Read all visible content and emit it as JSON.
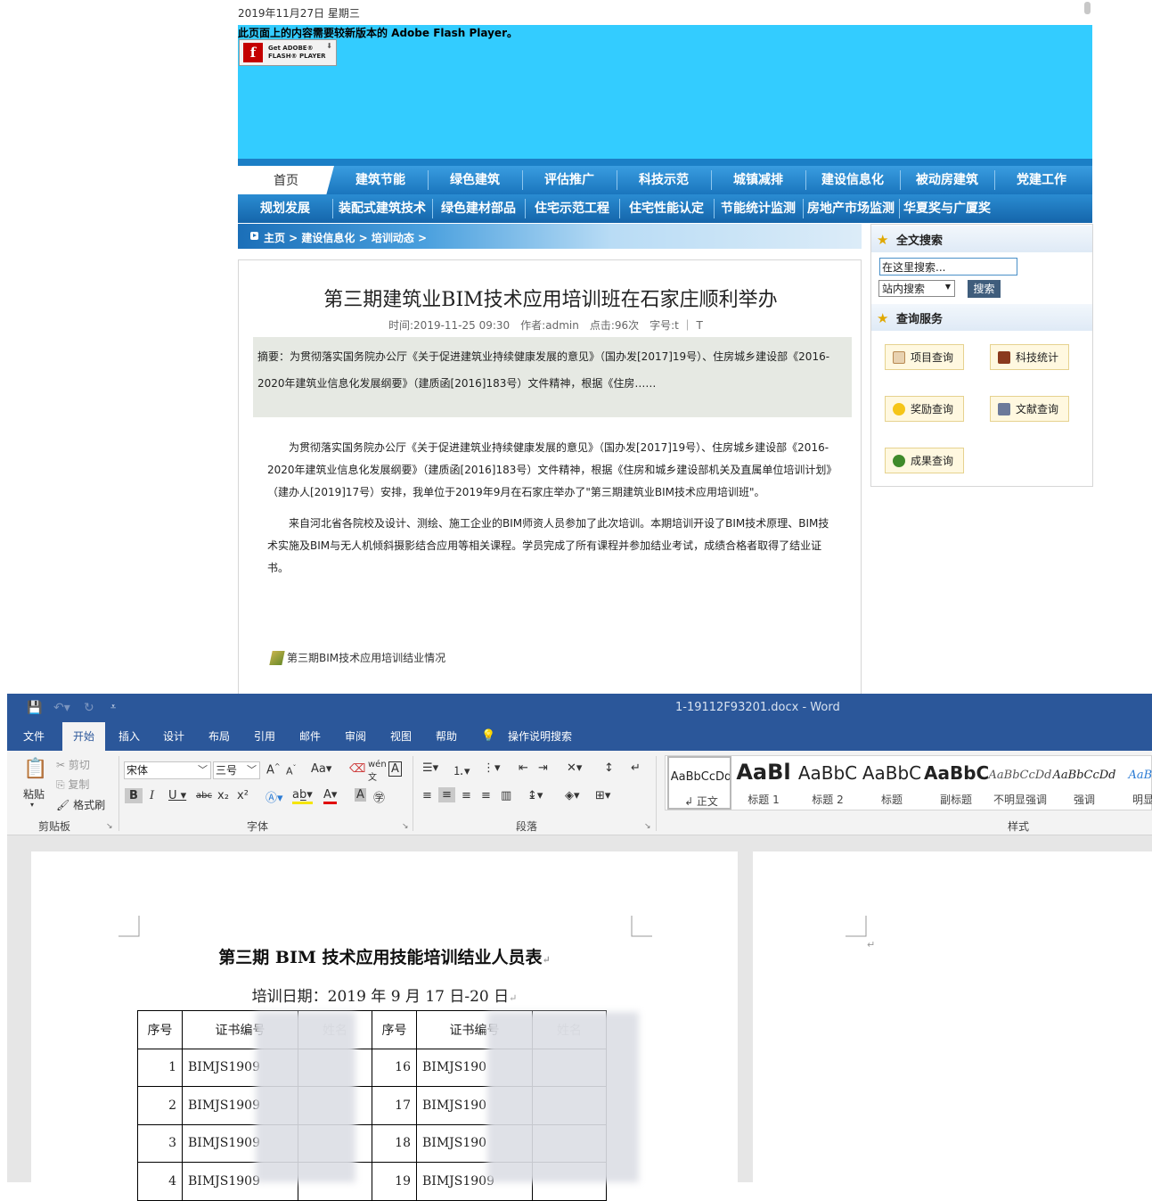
{
  "site": {
    "date": "2019年11月27日 星期三",
    "flash_message": "此页面上的内容需要较新版本的 Adobe Flash Player。",
    "flash_button": {
      "line1": "Get ADOBE®",
      "line2": "FLASH® PLAYER"
    },
    "nav_row1": [
      "首页",
      "建筑节能",
      "绿色建筑",
      "评估推广",
      "科技示范",
      "城镇减排",
      "建设信息化",
      "被动房建筑",
      "党建工作"
    ],
    "nav_row2": [
      "规划发展",
      "装配式建筑技术",
      "绿色建材部品",
      "住宅示范工程",
      "住宅性能认定",
      "节能统计监测",
      "房地产市场监测",
      "华夏奖与广厦奖"
    ],
    "breadcrumb": "主页 > 建设信息化 > 培训动态 >",
    "article": {
      "title": "第三期建筑业BIM技术应用培训班在石家庄顺利举办",
      "meta": "时间:2019-11-25 09:30　作者:admin　点击:96次　字号:t ｜ T",
      "abstract": "摘要：为贯彻落实国务院办公厅《关于促进建筑业持续健康发展的意见》（国办发[2017]19号）、住房城乡建设部《2016-2020年建筑业信息化发展纲要》（建质函[2016]183号）文件精神，根据《住房……",
      "para1": "为贯彻落实国务院办公厅《关于促进建筑业持续健康发展的意见》（国办发[2017]19号）、住房城乡建设部《2016-2020年建筑业信息化发展纲要》（建质函[2016]183号）文件精神，根据《住房和城乡建设部机关及直属单位培训计划》（建办人[2019]17号）安排，我单位于2019年9月在石家庄举办了\"第三期建筑业BIM技术应用培训班\"。",
      "para2": "来自河北省各院校及设计、测绘、施工企业的BIM师资人员参加了此次培训。本期培训开设了BIM技术原理、BIM技术实施及BIM与无人机倾斜摄影结合应用等相关课程。学员完成了所有课程并参加结业考试，成绩合格者取得了结业证书。",
      "attachment": "第三期BIM技术应用培训结业情况"
    },
    "sidebar": {
      "search_title": "全文搜索",
      "search_placeholder": "在这里搜索...",
      "search_scope": "站内搜索",
      "search_button": "搜索",
      "query_title": "查询服务",
      "query_buttons": [
        "项目查询",
        "科技统计",
        "奖励查询",
        "文献查询",
        "成果查询"
      ]
    }
  },
  "word": {
    "doc_title": "1-19112F93201.docx  -  Word",
    "tabs": [
      "文件",
      "开始",
      "插入",
      "设计",
      "布局",
      "引用",
      "邮件",
      "审阅",
      "视图",
      "帮助",
      "操作说明搜索"
    ],
    "active_tab": "开始",
    "clipboard": {
      "paste": "粘贴",
      "cut": "剪切",
      "copy": "复制",
      "format_painter": "格式刷",
      "group": "剪贴板"
    },
    "font": {
      "name": "宋体",
      "size": "三号",
      "group": "字体"
    },
    "paragraph_group": "段落",
    "styles_group": "样式",
    "styles": [
      {
        "preview": "AaBbCcDd",
        "name": "↲ 正文"
      },
      {
        "preview": "AaBl",
        "name": "标题 1"
      },
      {
        "preview": "AaBbC",
        "name": "标题 2"
      },
      {
        "preview": "AaBbC",
        "name": "标题"
      },
      {
        "preview": "AaBbC",
        "name": "副标题"
      },
      {
        "preview": "AaBbCcDd",
        "name": "不明显强调"
      },
      {
        "preview": "AaBbCcDd",
        "name": "强调"
      },
      {
        "preview": "AaBbC",
        "name": "明显强"
      }
    ],
    "document": {
      "title": "第三期 BIM 技术应用技能培训结业人员表",
      "date_line": "培训日期：2019 年 9 月 17 日-20 日",
      "headers": [
        "序号",
        "证书编号",
        "姓名",
        "序号",
        "证书编号",
        "姓名"
      ],
      "rows": [
        [
          "1",
          "BIMJS1909",
          "",
          "16",
          "BIMJS190",
          ""
        ],
        [
          "2",
          "BIMJS1909",
          "",
          "17",
          "BIMJS190",
          ""
        ],
        [
          "3",
          "BIMJS1909",
          "",
          "18",
          "BIMJS190",
          ""
        ],
        [
          "4",
          "BIMJS1909",
          "",
          "19",
          "BIMJS1909",
          ""
        ]
      ]
    }
  }
}
